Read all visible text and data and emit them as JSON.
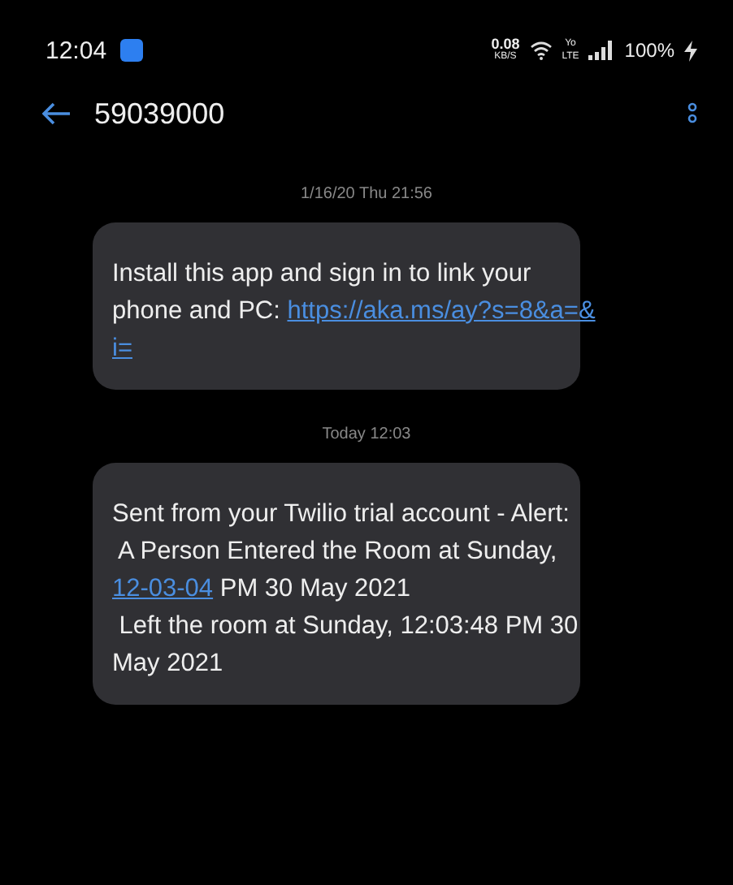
{
  "status_bar": {
    "time": "12:04",
    "net_speed": "0.08",
    "net_unit": "KB/S",
    "volte": "Yo",
    "volte_sub": "LTE",
    "battery": "100%"
  },
  "header": {
    "title": "59039000"
  },
  "messages": [
    {
      "timestamp": "1/16/20 Thu 21:56",
      "lines": [
        [
          {
            "kind": "text",
            "text": "Install this app and sign in to link your"
          }
        ],
        [
          {
            "kind": "text",
            "text": "phone and PC: "
          },
          {
            "kind": "link",
            "text": "https://aka.ms/ay?s=8&a=&"
          }
        ],
        [
          {
            "kind": "link",
            "text": "i="
          }
        ]
      ]
    },
    {
      "timestamp": "Today 12:03",
      "lines": [
        [
          {
            "kind": "text",
            "text": "Sent from your Twilio trial account - Alert:"
          }
        ],
        [
          {
            "kind": "text",
            "text": " A Person Entered the Room at Sunday,"
          }
        ],
        [
          {
            "kind": "link",
            "text": "12-03-04"
          },
          {
            "kind": "text",
            "text": " PM 30 May 2021"
          }
        ],
        [
          {
            "kind": "text",
            "text": " Left the room at Sunday, 12:03:48 PM 30"
          }
        ],
        [
          {
            "kind": "text",
            "text": "May 2021"
          }
        ]
      ]
    }
  ]
}
